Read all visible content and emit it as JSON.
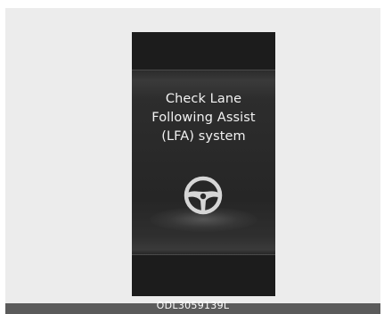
{
  "display": {
    "message_lines": [
      "Check Lane",
      "Following Assist",
      "(LFA) system"
    ],
    "icon": "steering-wheel-icon"
  },
  "caption": {
    "code": "ODL3059139L"
  }
}
